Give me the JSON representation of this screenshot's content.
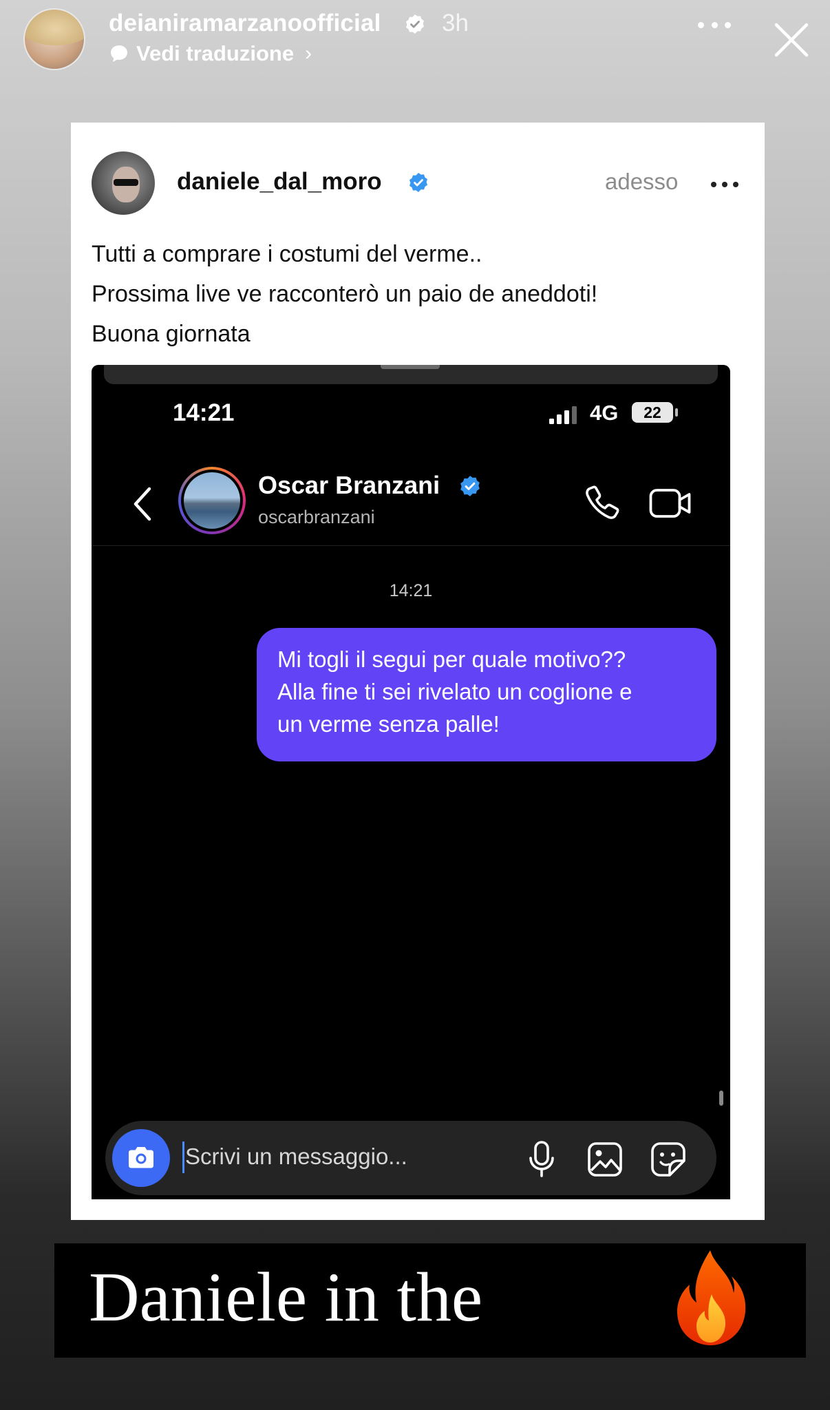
{
  "story": {
    "username": "deianiramarzanoofficial",
    "time": "3h",
    "translate_label": "Vedi traduzione",
    "translate_chevron": "›"
  },
  "post": {
    "username": "daniele_dal_moro",
    "time": "adesso",
    "caption_lines": [
      "Tutti a comprare i costumi del verme..",
      "Prossima live ve racconterò un paio de aneddoti!",
      "Buona giornata"
    ]
  },
  "phone": {
    "status_time": "14:21",
    "network": "4G",
    "battery": "22"
  },
  "dm": {
    "contact_name": "Oscar Branzani",
    "contact_handle": "oscarbranzani",
    "message_time": "14:21",
    "message_lines": [
      "Mi togli il segui per quale motivo??",
      "Alla fine ti sei rivelato un coglione e",
      "un verme senza palle!"
    ],
    "composer_placeholder": "Scrivi un messaggio..."
  },
  "overlay": {
    "text": "Daniele in the",
    "emoji": "fire-icon"
  },
  "colors": {
    "verified_blue": "#3897f0",
    "bubble_purple": "#6243f5",
    "camera_blue": "#3d6af5"
  }
}
